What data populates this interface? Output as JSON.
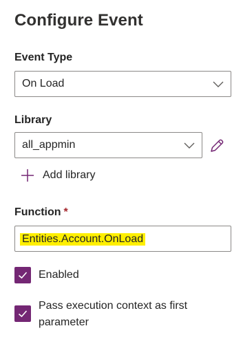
{
  "header": {
    "title": "Configure Event"
  },
  "event_type": {
    "label": "Event Type",
    "selected": "On Load"
  },
  "library": {
    "label": "Library",
    "selected": "all_appmin",
    "edit_icon": "pencil-icon",
    "add_label": "Add library",
    "add_icon": "plus-icon"
  },
  "function": {
    "label": "Function",
    "required_marker": "*",
    "value": "Entities.Account.OnLoad",
    "highlight_color": "#ffef00"
  },
  "options": {
    "enabled_label": "Enabled",
    "enabled_checked": true,
    "pass_context_label": "Pass execution context as first parameter",
    "pass_context_checked": true
  },
  "colors": {
    "accent": "#742774",
    "border": "#8a8886",
    "text": "#242424"
  }
}
